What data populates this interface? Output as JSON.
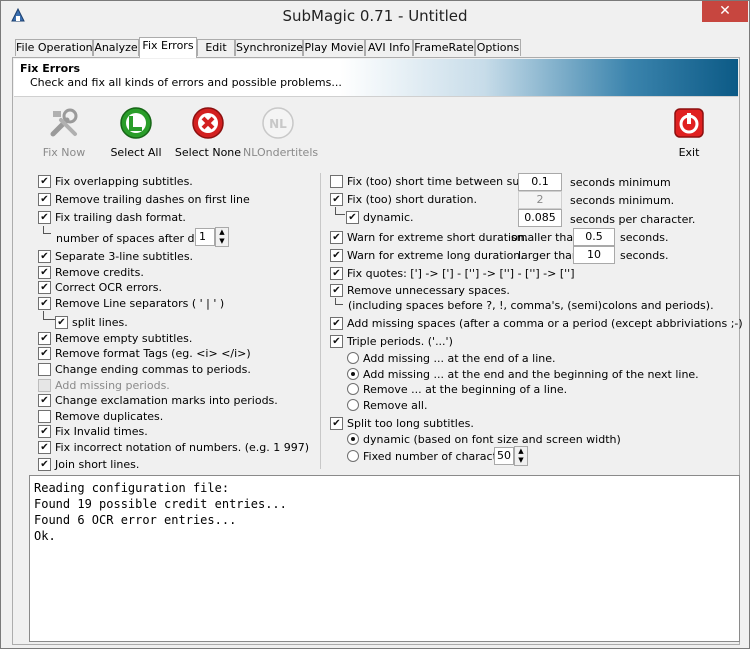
{
  "window": {
    "title": "SubMagic 0.71 - Untitled",
    "close_glyph": "✕"
  },
  "tabs": [
    {
      "label": "File Operations"
    },
    {
      "label": "Analyze"
    },
    {
      "label": "Fix Errors"
    },
    {
      "label": "Edit"
    },
    {
      "label": "Synchronize"
    },
    {
      "label": "Play Movie"
    },
    {
      "label": "AVI Info"
    },
    {
      "label": "FrameRate"
    },
    {
      "label": "Options"
    }
  ],
  "active_tab": "Fix Errors",
  "banner": {
    "title": "Fix Errors",
    "subtitle": "Check and fix all kinds of errors and possible problems..."
  },
  "toolbar": {
    "fix_now": "Fix Now",
    "select_all": "Select All",
    "select_none": "Select None",
    "nl": "NLOndertitels",
    "nl_icon_text": "NL",
    "exit": "Exit"
  },
  "left_options": {
    "fix_overlapping": "Fix overlapping subtitles.",
    "remove_trailing_dashes": "Remove trailing dashes on first line",
    "fix_trailing_dash": "Fix trailing dash format.",
    "spaces_after_dash_label": "number of spaces after dash:",
    "spaces_after_dash_value": "1",
    "separate_3line": "Separate 3-line subtitles.",
    "remove_credits": "Remove credits.",
    "correct_ocr": "Correct OCR errors.",
    "remove_line_separators": "Remove Line separators ( ' | ' )",
    "split_lines": "split lines.",
    "remove_empty": "Remove empty subtitles.",
    "remove_format_tags": "Remove format Tags (eg. <i> </i>)",
    "change_ending_commas": "Change ending commas to periods.",
    "add_missing_periods": "Add missing periods.",
    "change_exclamation": "Change exclamation marks into periods.",
    "remove_duplicates": "Remove duplicates.",
    "fix_invalid_times": "Fix Invalid times.",
    "fix_incorrect_notation": "Fix incorrect notation of numbers. (e.g. 1 997)",
    "join_short_lines": "Join short lines."
  },
  "right_options": {
    "fix_short_time": "Fix (too) short time between subtitles.",
    "short_time_value": "0.1",
    "short_time_unit": "seconds minimum",
    "fix_short_duration": "Fix (too) short duration.",
    "short_duration_value": "2",
    "short_duration_unit": "seconds minimum.",
    "dynamic": "dynamic.",
    "per_char_value": "0.085",
    "per_char_unit": "seconds per character.",
    "warn_short": "Warn for extreme short duration.",
    "smaller_than": "smaller than",
    "warn_short_value": "0.5",
    "warn_short_unit": "seconds.",
    "warn_long": "Warn for extreme long duration.",
    "larger_than": "larger than",
    "warn_long_value": "10",
    "warn_long_unit": "seconds.",
    "fix_quotes": "Fix quotes:  ['] -> [']   -   [''] -> ['']   -   [''] -> ['']",
    "remove_unnecessary_spaces": "Remove unnecessary spaces.",
    "unnecessary_spaces_note": "(including spaces before ?, !, comma's, (semi)colons and periods).",
    "add_missing_spaces": "Add missing spaces (after a comma or a period (except abbriviations ;-)",
    "triple_periods": "Triple periods. ('...')",
    "tp_add_end": "Add missing ... at the end of a line.",
    "tp_add_end_begin": "Add missing ... at the end and the beginning of the next line.",
    "tp_remove_begin": "Remove ... at the beginning of a line.",
    "tp_remove_all": "Remove all.",
    "split_too_long": "Split too long subtitles.",
    "split_dynamic": "dynamic (based on font size and screen width)",
    "split_fixed": "Fixed number of characters",
    "split_fixed_value": "50"
  },
  "log": [
    "Reading configuration file:",
    "Found 19 possible credit entries...",
    "Found 6 OCR error entries...",
    "Ok."
  ],
  "colors": {
    "green_icon": "#2a9d2a",
    "red_icon": "#d32020",
    "exit_icon": "#e02020",
    "banner_blue": "#0c5a86"
  }
}
